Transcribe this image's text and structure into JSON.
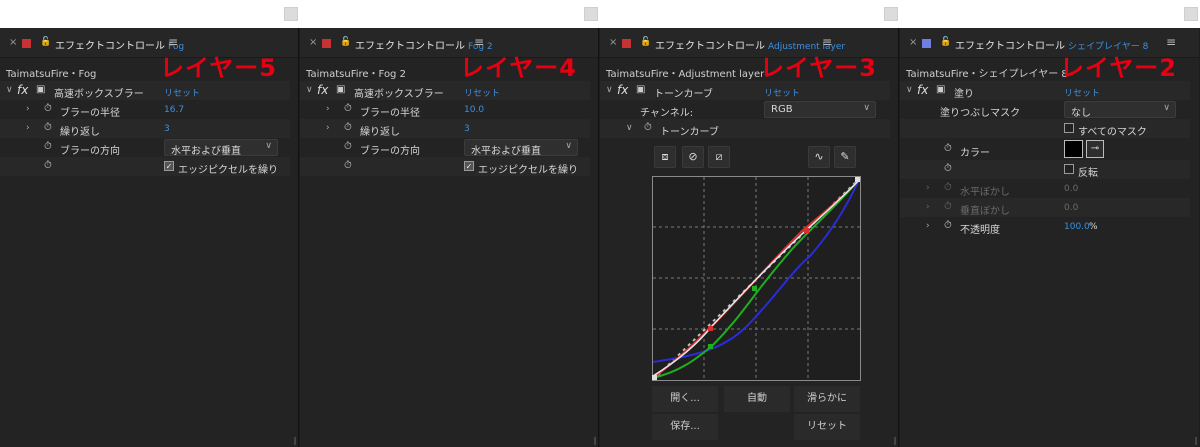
{
  "panels": [
    {
      "title": "エフェクトコントロール",
      "link": "Fog",
      "swatch_color": "#c83232",
      "subtitle": "TaimatsuFire・Fog",
      "big_label": "レイヤー5",
      "effect_name": "高速ボックスブラー",
      "reset": "リセット",
      "blur_radius_label": "ブラーの半径",
      "blur_radius_value": "16.7",
      "iterations_label": "繰り返し",
      "iterations_value": "3",
      "direction_label": "ブラーの方向",
      "direction_value": "水平および垂直",
      "edge_label": "エッジピクセルを繰り"
    },
    {
      "title": "エフェクトコントロール",
      "link": "Fog 2",
      "swatch_color": "#c83232",
      "subtitle": "TaimatsuFire・Fog 2",
      "big_label": "レイヤー4",
      "effect_name": "高速ボックスブラー",
      "reset": "リセット",
      "blur_radius_label": "ブラーの半径",
      "blur_radius_value": "10.0",
      "iterations_label": "繰り返し",
      "iterations_value": "3",
      "direction_label": "ブラーの方向",
      "direction_value": "水平および垂直",
      "edge_label": "エッジピクセルを繰り"
    },
    {
      "title": "エフェクトコントロール",
      "link": "Adjustment layer",
      "swatch_color": "#c83232",
      "subtitle": "TaimatsuFire・Adjustment layer",
      "big_label": "レイヤー3",
      "effect_name": "トーンカーブ",
      "reset": "リセット",
      "channel_label": "チャンネル:",
      "channel_value": "RGB",
      "curve_label": "トーンカーブ",
      "buttons": [
        "開く...",
        "自動",
        "滑らかに",
        "保存...",
        "リセット"
      ]
    },
    {
      "title": "エフェクトコントロール",
      "link": "シェイプレイヤー 8",
      "swatch_color": "#6e7fe0",
      "subtitle": "TaimatsuFire・シェイプレイヤー 8",
      "big_label": "レイヤー2",
      "effect_name": "塗り",
      "reset": "リセット",
      "mask_label": "塗りつぶしマスク",
      "mask_value": "なし",
      "all_masks_label": "すべてのマスク",
      "color_label": "カラー",
      "invert_label": "反転",
      "h_feather_label": "水平ぼかし",
      "h_feather_value": "0.0",
      "v_feather_label": "垂直ぼかし",
      "v_feather_value": "0.0",
      "opacity_label": "不透明度",
      "opacity_value": "100.0",
      "opacity_unit": "%"
    }
  ]
}
